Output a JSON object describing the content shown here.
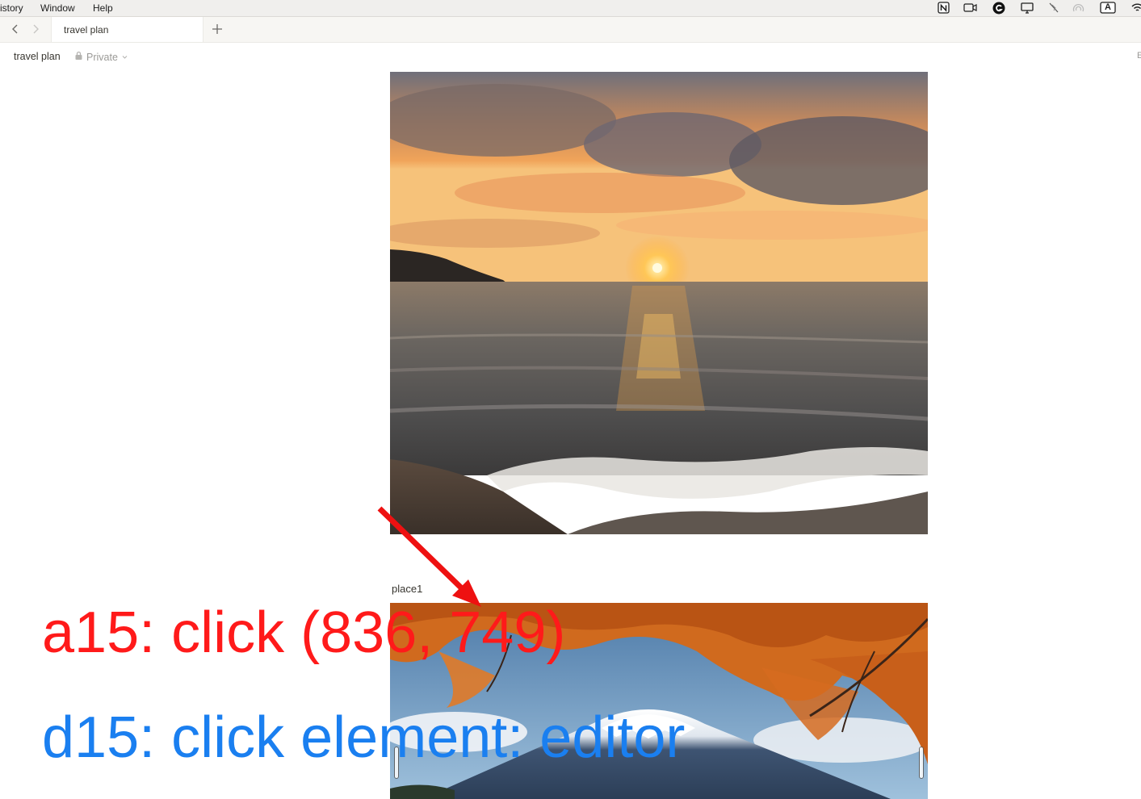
{
  "menubar": {
    "items": [
      "istory",
      "Window",
      "Help"
    ],
    "tray_icons": [
      "notion-icon",
      "screen-record-icon",
      "grammarly-icon",
      "display-icon",
      "mute-icon",
      "airdrop-icon",
      "input-source-icon",
      "wifi-icon"
    ],
    "input_source_label": "A"
  },
  "tabs": {
    "active_label": "travel plan"
  },
  "page": {
    "title": "travel plan",
    "privacy_label": "Private",
    "edge_letter": "E"
  },
  "content": {
    "image1_alt": "sunset-over-sea",
    "image2_caption": "place1",
    "image2_alt": "mount-fuji-autumn"
  },
  "overlay": {
    "action_text": "a15: click (836, 749)",
    "action_color": "#ff1a1a",
    "description_text": "d15: click element: editor",
    "description_color": "#1a7ff0"
  },
  "colors": {
    "menubar_bg": "#f0efed",
    "tabbar_bg": "#f7f6f3",
    "text": "#37352f",
    "muted": "#9b9a97"
  }
}
